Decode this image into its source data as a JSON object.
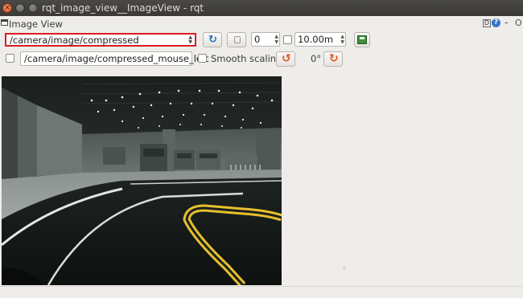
{
  "window": {
    "title": "rqt_image_view__ImageView - rqt",
    "close_glyph": "×"
  },
  "plugin": {
    "title": "Image View",
    "d_label": "D",
    "help_label": "?",
    "minimize_label": "-",
    "close_label": "O"
  },
  "toolbar": {
    "topic_combo_value": "/camera/image/compressed",
    "refresh_icon": "refresh-icon",
    "zoom_icon": "zoom-icon",
    "num_gridlines": "0",
    "max_distance": "10.00m",
    "save_icon": "save-icon"
  },
  "toolbar2": {
    "mouse_topic": "/camera/image/compressed_mouse_left",
    "smooth_label": "Smooth scaling",
    "rotation_label": "0°",
    "rotate_left_glyph": "↺",
    "rotate_right_glyph": "↻"
  },
  "colors": {
    "highlight": "#d81d1d",
    "accent_blue": "#2a6fc2",
    "accent_orange": "#e0541a"
  }
}
